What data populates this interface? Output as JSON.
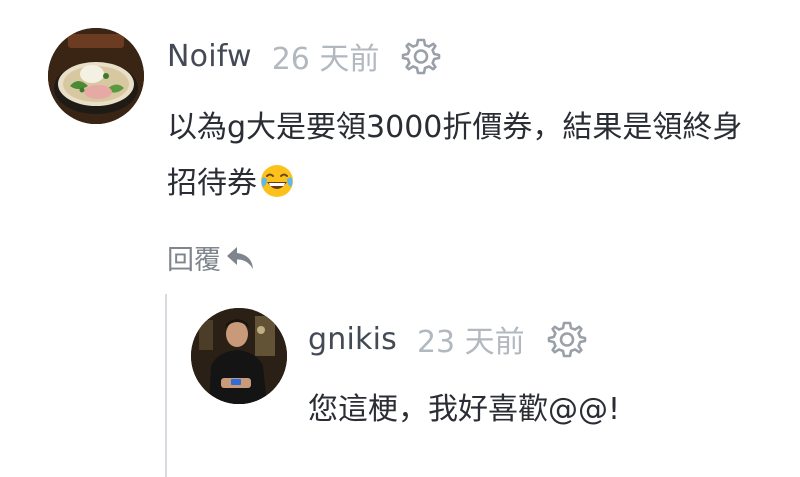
{
  "comments": [
    {
      "username": "Noifw",
      "time": "26 天前",
      "text_line1": "以為g大是要領3000折價券，結果是領終身",
      "text_line2": "招待券",
      "emoji": "face-with-tears-of-joy",
      "reply_label": "回覆"
    },
    {
      "username": "gnikis",
      "time": "23 天前",
      "text": "您這梗，我好喜歡@@!"
    }
  ],
  "colors": {
    "username": "#444a55",
    "time": "#b2b8c0",
    "text": "#2a2d33",
    "reply": "#7f858c",
    "thread_line": "#d7dadf",
    "icon": "#9aa0a8"
  },
  "icons": {
    "settings": "gear-icon",
    "reply": "reply-arrow-icon"
  }
}
